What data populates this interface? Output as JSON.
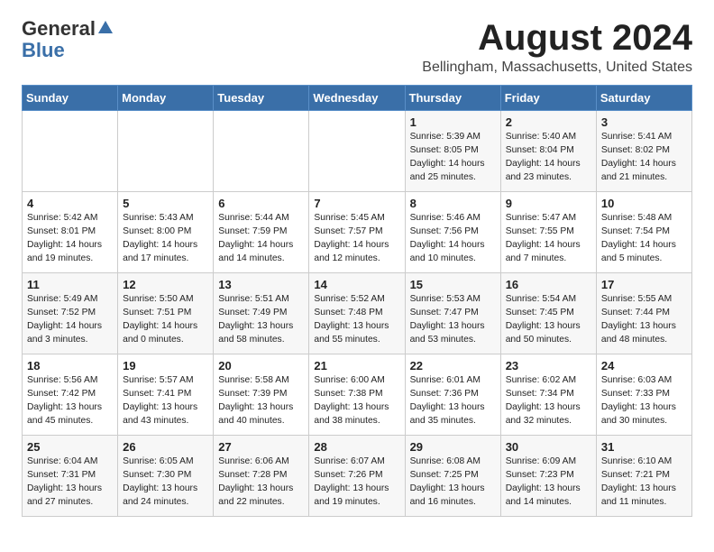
{
  "header": {
    "logo_general": "General",
    "logo_blue": "Blue",
    "main_title": "August 2024",
    "sub_title": "Bellingham, Massachusetts, United States"
  },
  "days_of_week": [
    "Sunday",
    "Monday",
    "Tuesday",
    "Wednesday",
    "Thursday",
    "Friday",
    "Saturday"
  ],
  "weeks": [
    [
      {
        "day": "",
        "content": ""
      },
      {
        "day": "",
        "content": ""
      },
      {
        "day": "",
        "content": ""
      },
      {
        "day": "",
        "content": ""
      },
      {
        "day": "1",
        "content": "Sunrise: 5:39 AM\nSunset: 8:05 PM\nDaylight: 14 hours and 25 minutes."
      },
      {
        "day": "2",
        "content": "Sunrise: 5:40 AM\nSunset: 8:04 PM\nDaylight: 14 hours and 23 minutes."
      },
      {
        "day": "3",
        "content": "Sunrise: 5:41 AM\nSunset: 8:02 PM\nDaylight: 14 hours and 21 minutes."
      }
    ],
    [
      {
        "day": "4",
        "content": "Sunrise: 5:42 AM\nSunset: 8:01 PM\nDaylight: 14 hours and 19 minutes."
      },
      {
        "day": "5",
        "content": "Sunrise: 5:43 AM\nSunset: 8:00 PM\nDaylight: 14 hours and 17 minutes."
      },
      {
        "day": "6",
        "content": "Sunrise: 5:44 AM\nSunset: 7:59 PM\nDaylight: 14 hours and 14 minutes."
      },
      {
        "day": "7",
        "content": "Sunrise: 5:45 AM\nSunset: 7:57 PM\nDaylight: 14 hours and 12 minutes."
      },
      {
        "day": "8",
        "content": "Sunrise: 5:46 AM\nSunset: 7:56 PM\nDaylight: 14 hours and 10 minutes."
      },
      {
        "day": "9",
        "content": "Sunrise: 5:47 AM\nSunset: 7:55 PM\nDaylight: 14 hours and 7 minutes."
      },
      {
        "day": "10",
        "content": "Sunrise: 5:48 AM\nSunset: 7:54 PM\nDaylight: 14 hours and 5 minutes."
      }
    ],
    [
      {
        "day": "11",
        "content": "Sunrise: 5:49 AM\nSunset: 7:52 PM\nDaylight: 14 hours and 3 minutes."
      },
      {
        "day": "12",
        "content": "Sunrise: 5:50 AM\nSunset: 7:51 PM\nDaylight: 14 hours and 0 minutes."
      },
      {
        "day": "13",
        "content": "Sunrise: 5:51 AM\nSunset: 7:49 PM\nDaylight: 13 hours and 58 minutes."
      },
      {
        "day": "14",
        "content": "Sunrise: 5:52 AM\nSunset: 7:48 PM\nDaylight: 13 hours and 55 minutes."
      },
      {
        "day": "15",
        "content": "Sunrise: 5:53 AM\nSunset: 7:47 PM\nDaylight: 13 hours and 53 minutes."
      },
      {
        "day": "16",
        "content": "Sunrise: 5:54 AM\nSunset: 7:45 PM\nDaylight: 13 hours and 50 minutes."
      },
      {
        "day": "17",
        "content": "Sunrise: 5:55 AM\nSunset: 7:44 PM\nDaylight: 13 hours and 48 minutes."
      }
    ],
    [
      {
        "day": "18",
        "content": "Sunrise: 5:56 AM\nSunset: 7:42 PM\nDaylight: 13 hours and 45 minutes."
      },
      {
        "day": "19",
        "content": "Sunrise: 5:57 AM\nSunset: 7:41 PM\nDaylight: 13 hours and 43 minutes."
      },
      {
        "day": "20",
        "content": "Sunrise: 5:58 AM\nSunset: 7:39 PM\nDaylight: 13 hours and 40 minutes."
      },
      {
        "day": "21",
        "content": "Sunrise: 6:00 AM\nSunset: 7:38 PM\nDaylight: 13 hours and 38 minutes."
      },
      {
        "day": "22",
        "content": "Sunrise: 6:01 AM\nSunset: 7:36 PM\nDaylight: 13 hours and 35 minutes."
      },
      {
        "day": "23",
        "content": "Sunrise: 6:02 AM\nSunset: 7:34 PM\nDaylight: 13 hours and 32 minutes."
      },
      {
        "day": "24",
        "content": "Sunrise: 6:03 AM\nSunset: 7:33 PM\nDaylight: 13 hours and 30 minutes."
      }
    ],
    [
      {
        "day": "25",
        "content": "Sunrise: 6:04 AM\nSunset: 7:31 PM\nDaylight: 13 hours and 27 minutes."
      },
      {
        "day": "26",
        "content": "Sunrise: 6:05 AM\nSunset: 7:30 PM\nDaylight: 13 hours and 24 minutes."
      },
      {
        "day": "27",
        "content": "Sunrise: 6:06 AM\nSunset: 7:28 PM\nDaylight: 13 hours and 22 minutes."
      },
      {
        "day": "28",
        "content": "Sunrise: 6:07 AM\nSunset: 7:26 PM\nDaylight: 13 hours and 19 minutes."
      },
      {
        "day": "29",
        "content": "Sunrise: 6:08 AM\nSunset: 7:25 PM\nDaylight: 13 hours and 16 minutes."
      },
      {
        "day": "30",
        "content": "Sunrise: 6:09 AM\nSunset: 7:23 PM\nDaylight: 13 hours and 14 minutes."
      },
      {
        "day": "31",
        "content": "Sunrise: 6:10 AM\nSunset: 7:21 PM\nDaylight: 13 hours and 11 minutes."
      }
    ]
  ]
}
